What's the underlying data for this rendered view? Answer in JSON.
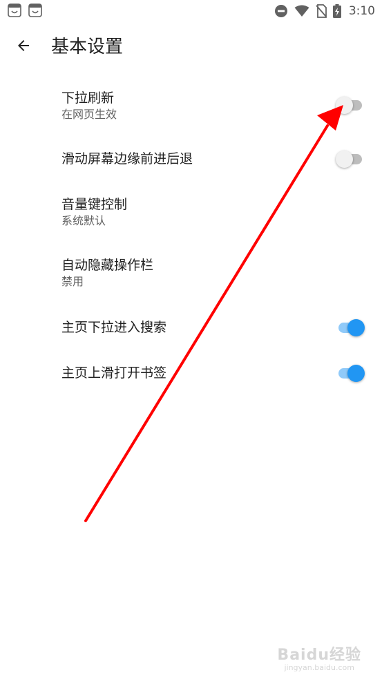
{
  "status_bar": {
    "time": "3:10",
    "left_icons": [
      "app-notification-icon",
      "app-notification-icon"
    ],
    "right_icons": [
      "do-not-disturb-icon",
      "wifi-icon",
      "no-sim-icon",
      "battery-charging-icon"
    ]
  },
  "header": {
    "back_icon": "arrow-left-icon",
    "title": "基本设置"
  },
  "settings": [
    {
      "title": "下拉刷新",
      "subtitle": "在网页生效",
      "switch": "off"
    },
    {
      "title": "滑动屏幕边缘前进后退",
      "subtitle": "",
      "switch": "off"
    },
    {
      "title": "音量键控制",
      "subtitle": "系统默认"
    },
    {
      "title": "自动隐藏操作栏",
      "subtitle": "禁用"
    },
    {
      "title": "主页下拉进入搜索",
      "subtitle": "",
      "switch": "on"
    },
    {
      "title": "主页上滑打开书签",
      "subtitle": "",
      "switch": "on"
    }
  ],
  "colors": {
    "switch_on_thumb": "#2196f3",
    "switch_on_track": "#90caf9",
    "switch_off_thumb": "#f1f1f1",
    "switch_off_track": "#bdbdbd",
    "annotation_arrow": "#ff0000"
  },
  "watermark": {
    "text": "Baidu经验",
    "url": "jingyan.baidu.com"
  }
}
